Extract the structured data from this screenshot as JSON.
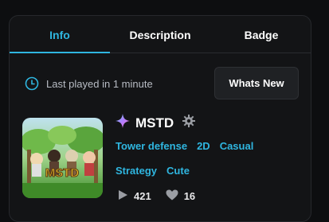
{
  "tabs": [
    {
      "label": "Info",
      "active": true
    },
    {
      "label": "Description",
      "active": false
    },
    {
      "label": "Badge",
      "active": false
    }
  ],
  "colors": {
    "accent": "#2fb6e0",
    "background": "#131416",
    "button_bg": "#1f2124"
  },
  "info": {
    "last_played": "Last played in 1 minute",
    "whats_new_label": "Whats New"
  },
  "game": {
    "name": "MSTD",
    "thumbnail_text": "MSTD",
    "tags": [
      "Tower defense",
      "2D",
      "Casual",
      "Strategy",
      "Cute"
    ],
    "plays": "421",
    "likes": "16",
    "icons": [
      "sparkle-icon",
      "gear-icon",
      "play-icon",
      "heart-icon",
      "clock-icon"
    ]
  }
}
